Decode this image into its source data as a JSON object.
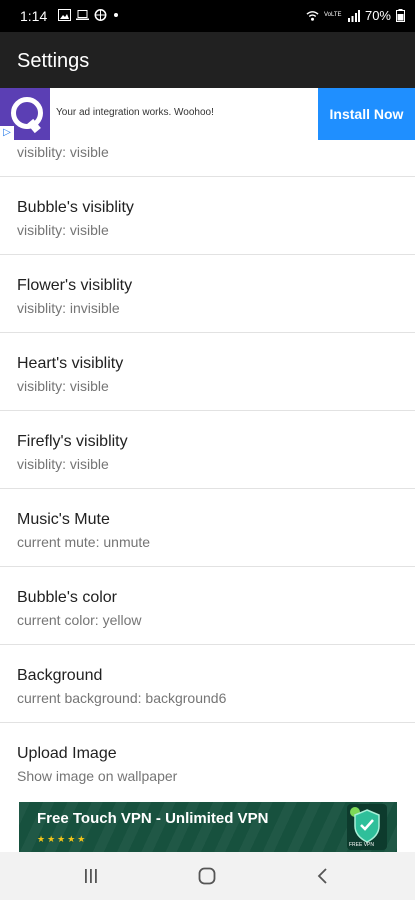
{
  "status_bar": {
    "time": "1:14",
    "signal_label": "VoLTE",
    "battery": "70%"
  },
  "app_bar": {
    "title": "Settings"
  },
  "ad_banner": {
    "text": "Your ad integration works. Woohoo!",
    "button_label": "Install Now",
    "brand_color": "#5b3fb4",
    "button_color": "#1f8fff"
  },
  "settings": {
    "partial_summary": "visiblity: visible",
    "items": [
      {
        "title": "Bubble's visiblity",
        "summary": "visiblity: visible"
      },
      {
        "title": "Flower's visiblity",
        "summary": "visiblity: invisible"
      },
      {
        "title": "Heart's visiblity",
        "summary": "visiblity: visible"
      },
      {
        "title": "Firefly's visiblity",
        "summary": "visiblity: visible"
      },
      {
        "title": "Music's Mute",
        "summary": "current mute: unmute"
      },
      {
        "title": "Bubble's color",
        "summary": "current color: yellow"
      },
      {
        "title": "Background",
        "summary": "current background: background6"
      },
      {
        "title": "Upload Image",
        "summary": "Show image on wallpaper"
      }
    ]
  },
  "vpn_ad": {
    "title": "Free Touch VPN - Unlimited VPN",
    "stars": "★★★★★",
    "shield_label": "FREE VPN",
    "background_color": "#17513e"
  },
  "nav_bar": {
    "icons": [
      "recents-icon",
      "home-icon",
      "back-icon"
    ]
  }
}
